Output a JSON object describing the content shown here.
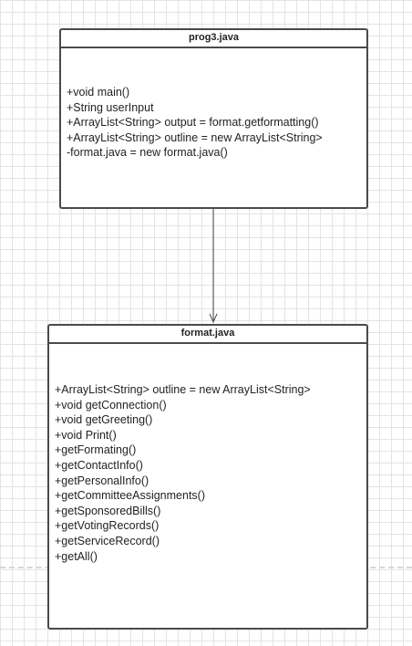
{
  "diagram": {
    "classes": [
      {
        "name": "prog3.java",
        "members": [
          "+void main()",
          "+String userInput",
          "+ArrayList<String> output = format.getformatting()",
          "+ArrayList<String> outline = new ArrayList<String>",
          "-format.java = new format.java()"
        ]
      },
      {
        "name": "format.java",
        "members": [
          "+ArrayList<String> outline = new ArrayList<String>",
          "+void getConnection()",
          "+void getGreeting()",
          "+void Print()",
          "+getFormating()",
          "+getContactInfo()",
          "+getPersonalInfo()",
          "+getCommitteeAssignments()",
          "+getSponsoredBills()",
          "+getVotingRecords()",
          "+getServiceRecord()",
          "+getAll()"
        ]
      }
    ],
    "relationships": [
      {
        "from": "prog3.java",
        "to": "format.java",
        "type": "association",
        "arrow": "open"
      }
    ]
  },
  "colors": {
    "border": "#4a4a4a",
    "text": "#222222",
    "grid": "#e4e4e4",
    "background": "#ffffff"
  }
}
